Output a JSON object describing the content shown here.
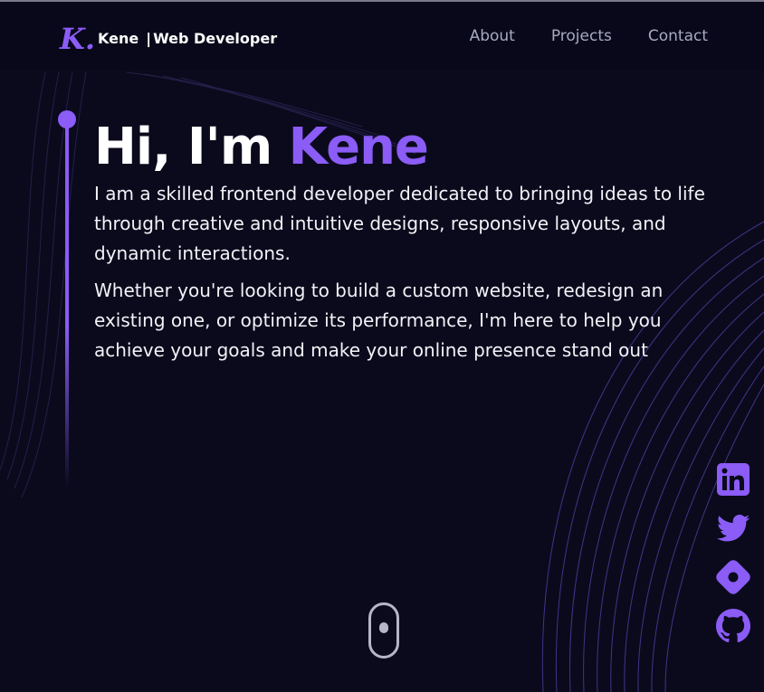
{
  "brand": {
    "logo_letter": "K.",
    "name": "Kene",
    "separator": "|",
    "role": "Web Developer"
  },
  "nav": {
    "links": [
      "About",
      "Projects",
      "Contact"
    ]
  },
  "hero": {
    "greeting": "Hi, I'm",
    "name": "Kene",
    "paragraphs": [
      "I am a skilled frontend developer dedicated to bringing ideas to life through creative and intuitive designs, responsive layouts, and dynamic interactions.",
      "Whether you're looking to build a custom website, redesign an existing one, or optimize its performance, I'm here to help you achieve your goals and make your online presence stand out"
    ]
  },
  "socials": [
    "linkedin-icon",
    "twitter-icon",
    "hashnode-icon",
    "github-icon"
  ],
  "colors": {
    "accent": "#8b5cf6",
    "background": "#0a0a1c",
    "nav_text": "#a9a9c0",
    "text": "#ffffff"
  }
}
